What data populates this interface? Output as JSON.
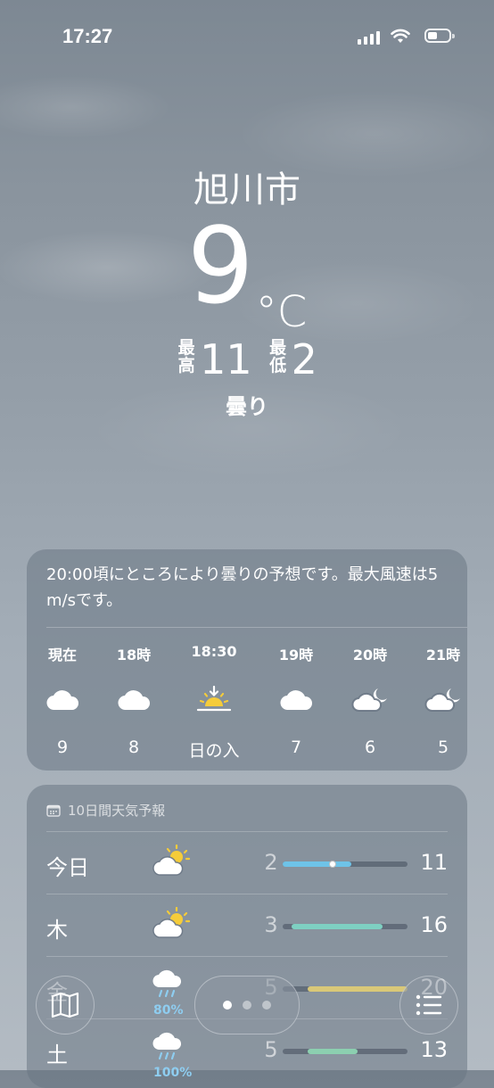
{
  "status": {
    "time": "17:27"
  },
  "header": {
    "city": "旭川市",
    "temperature": "9",
    "unit": "°C",
    "high_label": "最高",
    "high": "11",
    "low_label": "最低",
    "low": "2",
    "condition": "曇り"
  },
  "summary": {
    "text": "20:00頃にところにより曇りの予想です。最大風速は5 m/sです。",
    "hours": [
      {
        "label": "現在",
        "icon": "cloud-icon",
        "value": "9"
      },
      {
        "label": "18時",
        "icon": "cloud-icon",
        "value": "8"
      },
      {
        "label": "18:30",
        "icon": "sunset-icon",
        "value": "日の入"
      },
      {
        "label": "19時",
        "icon": "cloud-icon",
        "value": "7"
      },
      {
        "label": "20時",
        "icon": "cloud-moon-icon",
        "value": "6"
      },
      {
        "label": "21時",
        "icon": "cloud-moon-icon",
        "value": "5"
      }
    ]
  },
  "tenday": {
    "title": "10日間天気予報",
    "rows": [
      {
        "day": "今日",
        "icon": "cloud-sun-icon",
        "low": "2",
        "high": "11",
        "bar_start": 0.0,
        "bar_end": 0.55,
        "current": 0.4,
        "bar_color": "#6ec3e8"
      },
      {
        "day": "木",
        "icon": "cloud-sun-icon",
        "low": "3",
        "high": "16",
        "bar_start": 0.07,
        "bar_end": 0.8,
        "bar_color": "#7ed0c2"
      },
      {
        "day": "金",
        "icon": "rain-icon",
        "pct": "80%",
        "low": "5",
        "high": "20",
        "bar_start": 0.2,
        "bar_end": 1.0,
        "bar_color": "#d9c878"
      },
      {
        "day": "土",
        "icon": "rain-icon",
        "pct": "100%",
        "low": "5",
        "high": "13",
        "bar_start": 0.2,
        "bar_end": 0.6,
        "bar_color": "#8ccfb0"
      }
    ]
  },
  "toolbar": {
    "page_count": 3,
    "active_page": 0
  }
}
